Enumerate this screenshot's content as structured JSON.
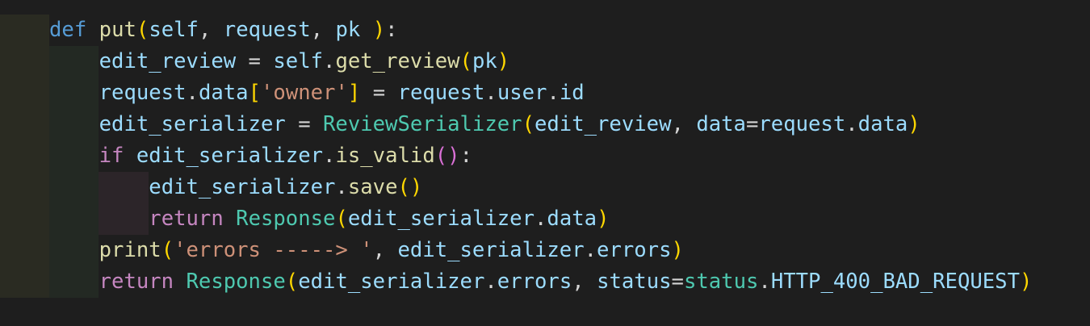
{
  "editor": {
    "language": "python",
    "colors": {
      "background": "#1e1e1e",
      "keyword": "#569cd6",
      "control_keyword": "#c586c0",
      "function": "#dcdcaa",
      "variable": "#9cdcfe",
      "class": "#4ec9b0",
      "string": "#ce9178",
      "bracket": "#ffd700",
      "constant": "#4fc1ff"
    },
    "lines": [
      {
        "tokens": [
          {
            "text": "def",
            "kind": "kw-def"
          },
          {
            "text": " ",
            "kind": "plain"
          },
          {
            "text": "put",
            "kind": "fn"
          },
          {
            "text": "(",
            "kind": "brace"
          },
          {
            "text": "self",
            "kind": "var"
          },
          {
            "text": ", ",
            "kind": "plain"
          },
          {
            "text": "request",
            "kind": "var"
          },
          {
            "text": ", ",
            "kind": "plain"
          },
          {
            "text": "pk",
            "kind": "var"
          },
          {
            "text": " ",
            "kind": "plain"
          },
          {
            "text": ")",
            "kind": "brace"
          },
          {
            "text": ":",
            "kind": "plain"
          }
        ]
      },
      {
        "tokens": [
          {
            "text": "    ",
            "kind": "plain"
          },
          {
            "text": "edit_review",
            "kind": "var"
          },
          {
            "text": " = ",
            "kind": "plain"
          },
          {
            "text": "self",
            "kind": "var"
          },
          {
            "text": ".",
            "kind": "plain"
          },
          {
            "text": "get_review",
            "kind": "fn"
          },
          {
            "text": "(",
            "kind": "brace"
          },
          {
            "text": "pk",
            "kind": "var"
          },
          {
            "text": ")",
            "kind": "brace"
          }
        ]
      },
      {
        "tokens": [
          {
            "text": "    ",
            "kind": "plain"
          },
          {
            "text": "request",
            "kind": "var"
          },
          {
            "text": ".",
            "kind": "plain"
          },
          {
            "text": "data",
            "kind": "var"
          },
          {
            "text": "[",
            "kind": "brace"
          },
          {
            "text": "'owner'",
            "kind": "str"
          },
          {
            "text": "]",
            "kind": "brace"
          },
          {
            "text": " = ",
            "kind": "plain"
          },
          {
            "text": "request",
            "kind": "var"
          },
          {
            "text": ".",
            "kind": "plain"
          },
          {
            "text": "user",
            "kind": "var"
          },
          {
            "text": ".",
            "kind": "plain"
          },
          {
            "text": "id",
            "kind": "var"
          }
        ]
      },
      {
        "tokens": [
          {
            "text": "    ",
            "kind": "plain"
          },
          {
            "text": "edit_serializer",
            "kind": "var"
          },
          {
            "text": " = ",
            "kind": "plain"
          },
          {
            "text": "ReviewSerializer",
            "kind": "cls"
          },
          {
            "text": "(",
            "kind": "brace"
          },
          {
            "text": "edit_review",
            "kind": "var"
          },
          {
            "text": ", ",
            "kind": "plain"
          },
          {
            "text": "data",
            "kind": "var"
          },
          {
            "text": "=",
            "kind": "plain"
          },
          {
            "text": "request",
            "kind": "var"
          },
          {
            "text": ".",
            "kind": "plain"
          },
          {
            "text": "data",
            "kind": "var"
          },
          {
            "text": ")",
            "kind": "brace"
          }
        ]
      },
      {
        "tokens": [
          {
            "text": "    ",
            "kind": "plain"
          },
          {
            "text": "if",
            "kind": "kw-ctrl"
          },
          {
            "text": " ",
            "kind": "plain"
          },
          {
            "text": "edit_serializer",
            "kind": "var"
          },
          {
            "text": ".",
            "kind": "plain"
          },
          {
            "text": "is_valid",
            "kind": "fn"
          },
          {
            "text": "()",
            "kind": "brace2"
          },
          {
            "text": ":",
            "kind": "plain"
          }
        ]
      },
      {
        "tokens": [
          {
            "text": "        ",
            "kind": "plain"
          },
          {
            "text": "edit_serializer",
            "kind": "var"
          },
          {
            "text": ".",
            "kind": "plain"
          },
          {
            "text": "save",
            "kind": "fn"
          },
          {
            "text": "()",
            "kind": "brace"
          }
        ]
      },
      {
        "tokens": [
          {
            "text": "        ",
            "kind": "plain"
          },
          {
            "text": "return",
            "kind": "kw-ctrl"
          },
          {
            "text": " ",
            "kind": "plain"
          },
          {
            "text": "Response",
            "kind": "cls"
          },
          {
            "text": "(",
            "kind": "brace"
          },
          {
            "text": "edit_serializer",
            "kind": "var"
          },
          {
            "text": ".",
            "kind": "plain"
          },
          {
            "text": "data",
            "kind": "var"
          },
          {
            "text": ")",
            "kind": "brace"
          }
        ]
      },
      {
        "tokens": [
          {
            "text": "    ",
            "kind": "plain"
          },
          {
            "text": "print",
            "kind": "fn"
          },
          {
            "text": "(",
            "kind": "brace"
          },
          {
            "text": "'errors -----> '",
            "kind": "str"
          },
          {
            "text": ", ",
            "kind": "plain"
          },
          {
            "text": "edit_serializer",
            "kind": "var"
          },
          {
            "text": ".",
            "kind": "plain"
          },
          {
            "text": "errors",
            "kind": "var"
          },
          {
            "text": ")",
            "kind": "brace"
          }
        ]
      },
      {
        "tokens": [
          {
            "text": "    ",
            "kind": "plain"
          },
          {
            "text": "return",
            "kind": "kw-ctrl"
          },
          {
            "text": " ",
            "kind": "plain"
          },
          {
            "text": "Response",
            "kind": "cls"
          },
          {
            "text": "(",
            "kind": "brace"
          },
          {
            "text": "edit_serializer",
            "kind": "var"
          },
          {
            "text": ".",
            "kind": "plain"
          },
          {
            "text": "errors",
            "kind": "var"
          },
          {
            "text": ", ",
            "kind": "plain"
          },
          {
            "text": "status",
            "kind": "var"
          },
          {
            "text": "=",
            "kind": "plain"
          },
          {
            "text": "status",
            "kind": "cls"
          },
          {
            "text": ".",
            "kind": "plain"
          },
          {
            "text": "HTTP_400_BAD_REQUEST",
            "kind": "var"
          },
          {
            "text": ")",
            "kind": "brace"
          }
        ]
      }
    ]
  }
}
